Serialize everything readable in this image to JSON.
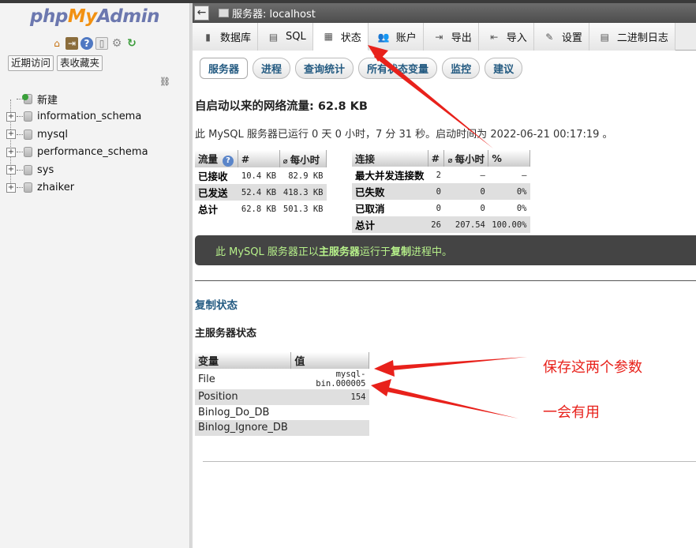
{
  "nav": {
    "logo": {
      "php": "php",
      "my": "My",
      "admin": "Admin"
    },
    "buttons": [
      "近期访问",
      "表收藏夹"
    ],
    "tree": [
      {
        "label": "新建",
        "expandable": false
      },
      {
        "label": "information_schema",
        "expandable": true
      },
      {
        "label": "mysql",
        "expandable": true
      },
      {
        "label": "performance_schema",
        "expandable": true
      },
      {
        "label": "sys",
        "expandable": true
      },
      {
        "label": "zhaiker",
        "expandable": true
      }
    ]
  },
  "breadcrumb": {
    "back": "←",
    "text": "服务器: localhost"
  },
  "tabs": [
    {
      "label": "数据库",
      "icon": "database-icon",
      "glyph": "▮"
    },
    {
      "label": "SQL",
      "icon": "sql-icon",
      "glyph": "▤"
    },
    {
      "label": "状态",
      "icon": "status-icon",
      "glyph": "▦",
      "active": true
    },
    {
      "label": "账户",
      "icon": "users-icon",
      "glyph": "👥"
    },
    {
      "label": "导出",
      "icon": "export-icon",
      "glyph": "⇥"
    },
    {
      "label": "导入",
      "icon": "import-icon",
      "glyph": "⇤"
    },
    {
      "label": "设置",
      "icon": "settings-icon",
      "glyph": "✎"
    },
    {
      "label": "二进制日志",
      "icon": "binlog-icon",
      "glyph": "▤"
    }
  ],
  "subtabs": [
    {
      "label": "服务器",
      "active": true
    },
    {
      "label": "进程"
    },
    {
      "label": "查询统计"
    },
    {
      "label": "所有状态变量"
    },
    {
      "label": "监控"
    },
    {
      "label": "建议"
    }
  ],
  "traffic": {
    "title": "自启动以来的网络流量: 62.8 KB",
    "uptime": "此 MySQL 服务器已运行 0 天 0 小时，7 分 31 秒。启动时间为 2022-06-21 00:17:19 。"
  },
  "traffic_table": {
    "headers": [
      "流量",
      "#",
      "每小时"
    ],
    "rows": [
      [
        "已接收",
        "10.4 KB",
        "82.9 KB"
      ],
      [
        "已发送",
        "52.4 KB",
        "418.3 KB"
      ],
      [
        "总计",
        "62.8 KB",
        "501.3 KB"
      ]
    ]
  },
  "conn_table": {
    "headers": [
      "连接",
      "#",
      "每小时",
      "%"
    ],
    "rows": [
      [
        "最大并发连接数",
        "2",
        "—",
        "—"
      ],
      [
        "已失败",
        "0",
        "0",
        "0%"
      ],
      [
        "已取消",
        "0",
        "0",
        "0%"
      ],
      [
        "总计",
        "26",
        "207.54",
        "100.00%"
      ]
    ]
  },
  "notice": {
    "pre": "此 MySQL 服务器正以",
    "role": "主服务器",
    "mid": "运行于",
    "link": "复制",
    "post": "进程中。"
  },
  "replication": {
    "title": "复制状态",
    "master_title": "主服务器状态",
    "headers": [
      "变量",
      "值"
    ],
    "rows": [
      [
        "File",
        "mysql-bin.000005"
      ],
      [
        "Position",
        "154"
      ],
      [
        "Binlog_Do_DB",
        ""
      ],
      [
        "Binlog_Ignore_DB",
        ""
      ]
    ]
  },
  "annotations": {
    "note1": "保存这两个参数",
    "note2": "一会有用",
    "color": "#e8211b"
  }
}
